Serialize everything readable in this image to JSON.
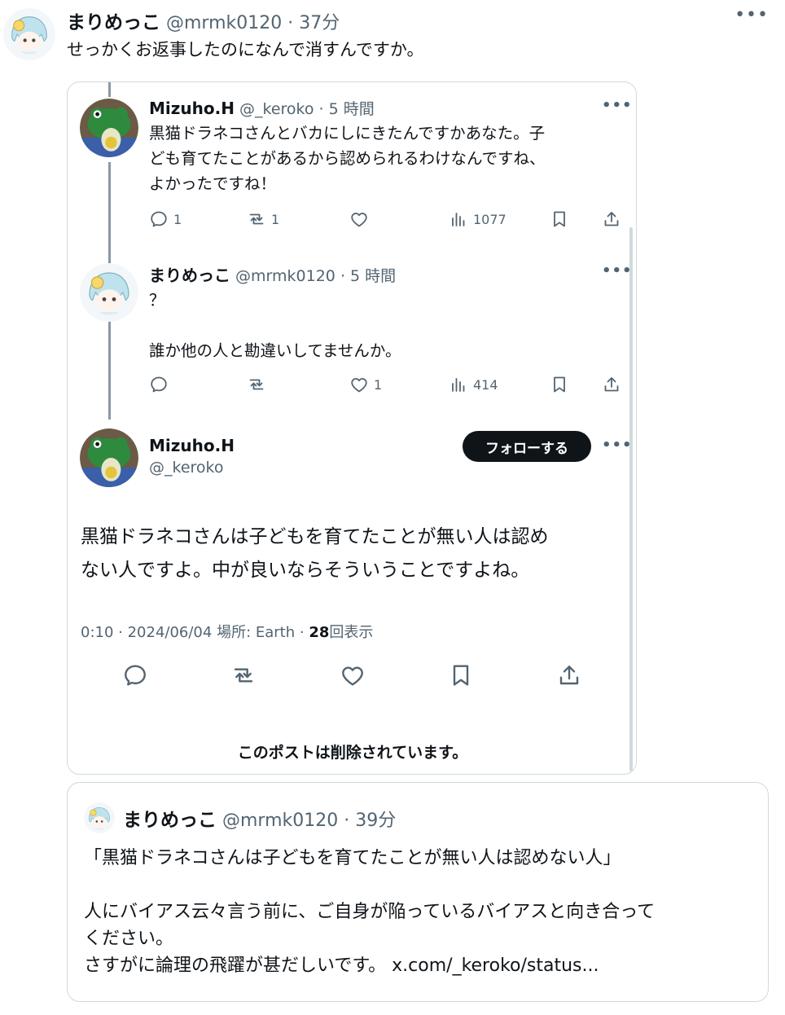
{
  "top_post": {
    "display_name": "まりめっこ",
    "handle": "@mrmk0120",
    "time": "37分",
    "text": "せっかくお返事したのになんで消すんですか。",
    "more_icon": "more-horizontal-icon"
  },
  "thread": {
    "post1": {
      "display_name": "Mizuho.H",
      "handle": "@_keroko",
      "time": "5 時間",
      "lines": [
        "黒猫ドラネコさんとバカにしにきたんですかあなた。子",
        "ども育てたことがあるから認められるわけなんですね、",
        "よかったですね！"
      ],
      "reply_count": "1",
      "repost_count": "1",
      "like_count": "",
      "views": "1077"
    },
    "post2": {
      "display_name": "まりめっこ",
      "handle": "@mrmk0120",
      "time": "5 時間",
      "line1": "？",
      "line2": "誰か他の人と勘違いしてませんか。",
      "reply_count": "",
      "repost_count": "",
      "like_count": "1",
      "views": "414"
    },
    "main": {
      "display_name": "Mizuho.H",
      "handle": "@_keroko",
      "follow_label": "フォローする",
      "lines": [
        "黒猫ドラネコさんは子どもを育てたことが無い人は認め",
        "ない人ですよ。中が良いならそういうことですよね。"
      ],
      "meta_time": "0:10 · 2024/06/04",
      "meta_location": "場所: Earth",
      "meta_views": "28",
      "meta_views_label": "回表示"
    },
    "deleted_notice": "このポストは削除されています。"
  },
  "quote": {
    "display_name": "まりめっこ",
    "handle": "@mrmk0120",
    "time": "39分",
    "line1": "「黒猫ドラネコさんは子どもを育てたことが無い人は認めない人」",
    "line2": "人にバイアス云々言う前に、ご自身が陥っているバイアスと向き合って",
    "line3": "ください。",
    "line4": "さすがに論理の飛躍が甚だしいです。",
    "link": "x.com/_keroko/status..."
  },
  "colors": {
    "text": "#0f1419",
    "muted": "#536471",
    "border": "#cfd9de",
    "frog_green": "#2e8b3e"
  }
}
